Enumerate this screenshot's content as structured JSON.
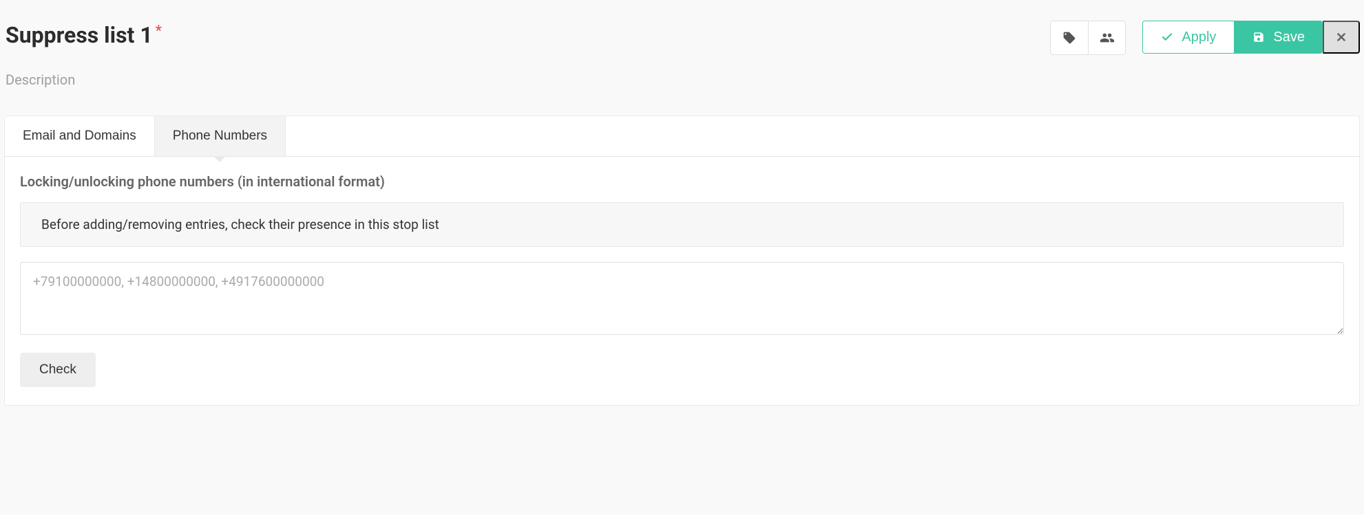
{
  "header": {
    "title": "Suppress list 1",
    "required_marker": "*",
    "description": "Description"
  },
  "toolbar": {
    "apply_label": "Apply",
    "save_label": "Save"
  },
  "tabs": [
    {
      "label": "Email and Domains",
      "active": false
    },
    {
      "label": "Phone Numbers",
      "active": true
    }
  ],
  "panel": {
    "section_label": "Locking/unlocking phone numbers (in international format)",
    "info_text": "Before adding/removing entries, check their presence in this stop list",
    "textarea_placeholder": "+79100000000, +14800000000, +4917600000000",
    "textarea_value": "",
    "check_label": "Check"
  }
}
